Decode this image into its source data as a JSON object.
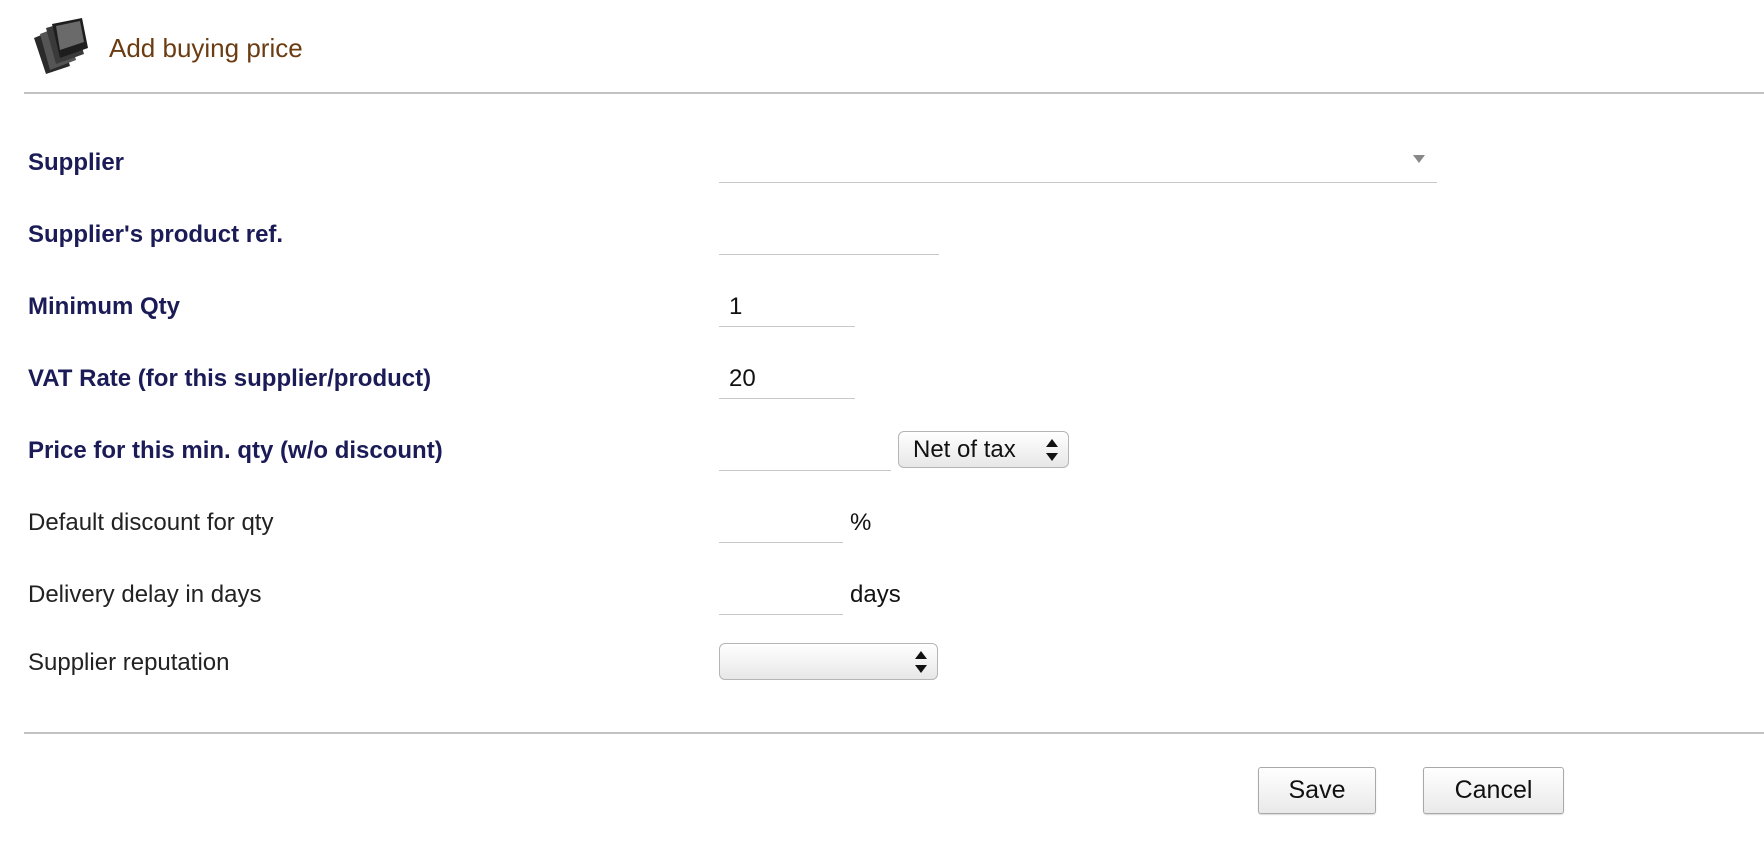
{
  "page": {
    "title": "Add buying price",
    "icon": "folders-icon"
  },
  "form": {
    "supplier": {
      "label": "Supplier",
      "value": ""
    },
    "supplier_ref": {
      "label": "Supplier's product ref.",
      "value": ""
    },
    "min_qty": {
      "label": "Minimum Qty",
      "value": "1"
    },
    "vat_rate": {
      "label": "VAT Rate (for this supplier/product)",
      "value": "20"
    },
    "price": {
      "label": "Price for this min. qty (w/o discount)",
      "value": "",
      "tax_mode": "Net of tax"
    },
    "discount": {
      "label": "Default discount for qty",
      "value": "",
      "suffix": "%"
    },
    "delivery_delay": {
      "label": "Delivery delay in days",
      "value": "",
      "suffix": "days"
    },
    "reputation": {
      "label": "Supplier reputation",
      "value": ""
    }
  },
  "actions": {
    "save": "Save",
    "cancel": "Cancel"
  },
  "colors": {
    "title": "#6b3c12",
    "required_label": "#1b1b57",
    "divider": "#c2c2c2"
  }
}
